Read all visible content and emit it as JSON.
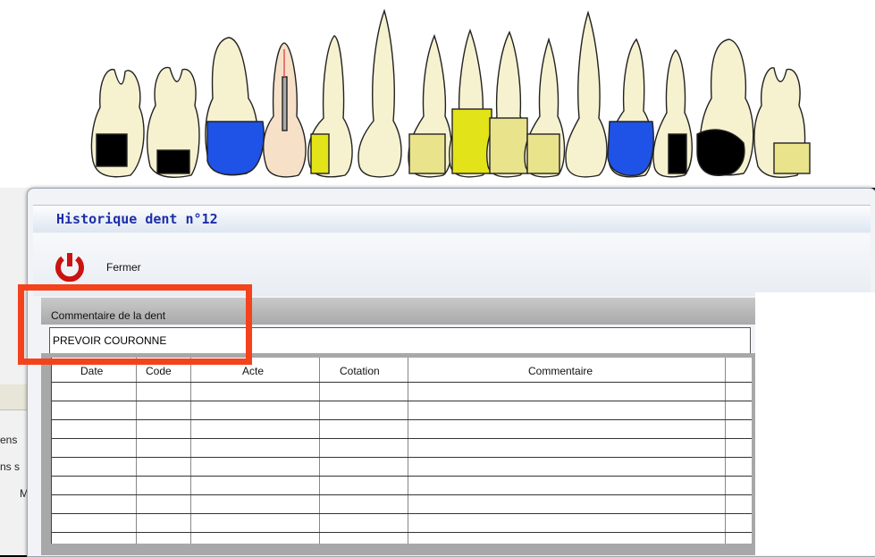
{
  "dialog": {
    "title": "Historique dent n°12",
    "close_label": "Fermer"
  },
  "comment": {
    "label": "Commentaire de la dent",
    "value": "PREVOIR COURONNE"
  },
  "history_table": {
    "columns": [
      "Date",
      "Code",
      "Acte",
      "Cotation",
      "Commentaire"
    ],
    "rows": []
  },
  "background_fragments": [
    "ens",
    "ns s",
    "M"
  ],
  "colors": {
    "title_text": "#1d2ea8",
    "highlight": "#f4421d",
    "treated_blue": "#1f52e6",
    "caries_black": "#000000",
    "composite_yellow": "#e3e31a",
    "tooth": "#f6f1cf"
  }
}
